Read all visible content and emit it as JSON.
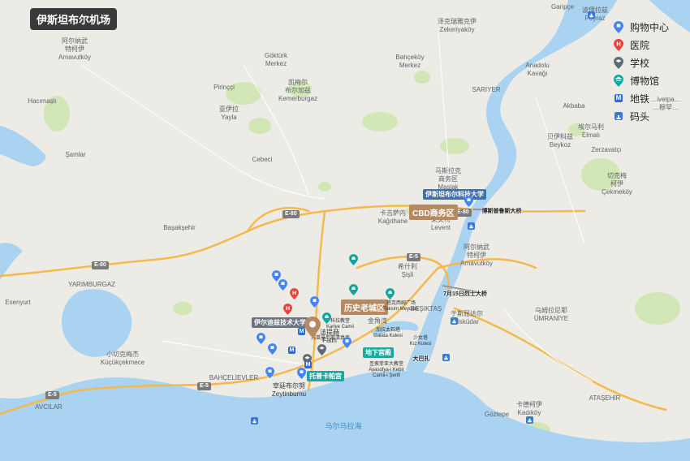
{
  "title": "伊斯坦布尔机场",
  "legend": {
    "shopping": "购物中心",
    "hospital": "医院",
    "school": "学校",
    "museum": "博物馆",
    "metro": "地铁",
    "ferry": "码头",
    "metro_symbol": "M"
  },
  "colors": {
    "water": "#a9d3f0",
    "land": "#ecebe6",
    "park": "#d2e6b6",
    "highway": "#f6b84d",
    "district_tag": "#b58a63",
    "shopping": "#4285f4",
    "hospital": "#ea4335",
    "school": "#5f6a78",
    "museum": "#12a5a0",
    "metro": "#2f6ad6"
  },
  "districts": {
    "cbd": "CBD商务区",
    "old_town": "历史老城区"
  },
  "highways": {
    "e80a": "E-80",
    "e80b": "E-80",
    "e80c": "E-80",
    "e5a": "E-5",
    "e5b": "E-5",
    "e5c": "E-5"
  },
  "places": {
    "arnavutkoy": "阿尔纳武\n特柯伊\nArnavutköy",
    "gokturk": "Göktürk\nMerkez",
    "kemerburgaz": "凯梅尔\n布尔加兹\nKemerburgaz",
    "zekeriyakoy": "泽克瑞雅克伊\nZekeriyaköy",
    "bahcekoy": "Bahçeköy\nMerkez",
    "poyraz": "波伊拉兹\nPoyraz",
    "garipce": "Garipçe",
    "hacimasli": "Hacımaşlı",
    "pirincci": "Pirinççi",
    "yayla": "亚伊拉\nYayla",
    "samlar": "Şamlar",
    "cebeci": "Cebeci",
    "sariyer": "SARIYER",
    "anadolu_kavagi": "Anadolu\nKavağı",
    "akbaba": "Akbaba",
    "riva_partial": "…ivetpa…\n…穆罕…",
    "elmali": "埃尔马利\nElmalı",
    "beykoz": "贝伊科兹\nBeykoz",
    "zerzavatci": "Zerzavatçı",
    "maslak": "马斯拉克\n商务区\nMaslak",
    "kagithane": "卡吉萨内\nKağıthane",
    "levent": "莱文特\nLevent",
    "arnavutkoy_bos": "阿尔纳武\n特柯伊\nArnavutköy",
    "basaksehir": "Başakşehir",
    "yarimburgaz": "YARIMBURGAZ",
    "esenyurt": "Esenyurt",
    "kucukcekmece": "小切克梅杰\nKüçükçekmece",
    "sisli": "希什利\nŞişli",
    "besiktas": "BEŞIKTAŞ",
    "uskudar": "于斯屈达尔\nÜsküdar",
    "umraniye": "乌姆拉尼耶\nÜMRANİYE",
    "bahcelievler": "BAHÇELİEVLER",
    "avcilar": "AVCILAR",
    "zeytinburnu": "宰廷布尔努\nZeytinburnu",
    "fatih": "法提赫\nFatih",
    "golden_horn": "金角湾",
    "kadikoy": "卡德柯伊\nKadıköy",
    "goztepe": "Göztepe",
    "atasehir": "ATAŞEHİR",
    "marmara": "马尔马拉海",
    "cekmekoy": "切克梅\n柯伊\nÇekmeköy"
  },
  "landmarks": {
    "itu": "伊斯坦布尔科技大学",
    "fsm_bridge": "博斯普鲁斯大桥",
    "july15_bridge": "7月15日烈士大桥",
    "yildiz_uni": "伊尔迪兹技术大学",
    "grand_bazaar": "大巴扎",
    "cistern": "地下宫殿",
    "topkapi": "托普卡帕宫",
    "chora": "科拉教堂\nKariye Camii",
    "galata": "加拉太石塔\nGalata Kulesi",
    "maiden": "少女塔\nKız Kulesi",
    "taksim": "塔克西姆广场\nTaksim Meydanı",
    "hagia": "圣索菲亚大教堂\nAyasofya-i Kebir\nCamii-i Şerifi",
    "suleymaniye": "苏莱曼尼耶清真寺"
  }
}
